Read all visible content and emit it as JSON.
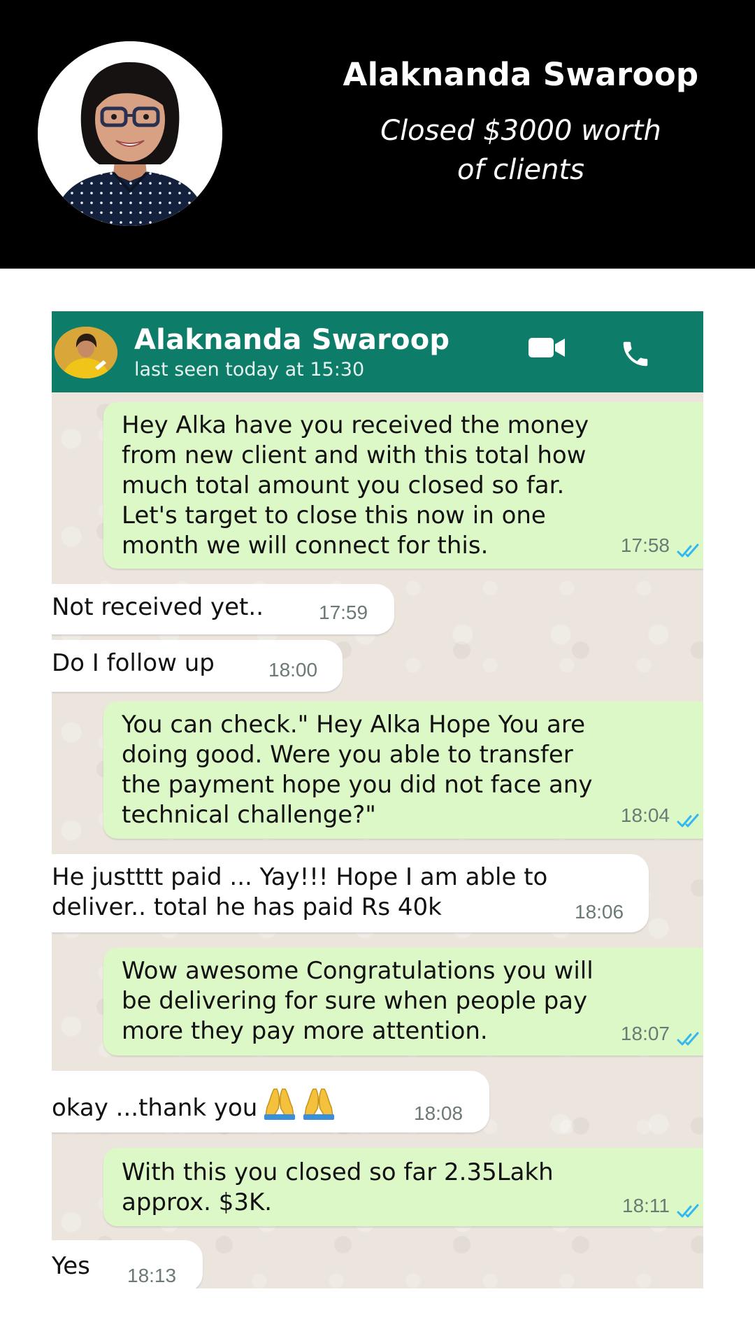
{
  "banner": {
    "name": "Alaknanda Swaroop",
    "subtitle_line1": "Closed $3000 worth",
    "subtitle_line2": "of clients"
  },
  "chat": {
    "contact_name": "Alaknanda Swaroop",
    "last_seen": "last seen today at 15:30",
    "header_icons": [
      "video-call-icon",
      "phone-call-icon"
    ],
    "colors": {
      "header": "#0d7d69",
      "outgoing": "#dcf8c6",
      "incoming": "#ffffff",
      "background": "#ebe5de",
      "read_ticks": "#34b7f1"
    },
    "messages": [
      {
        "dir": "out",
        "text": "Hey Alka have you received the money\nfrom new client and with this total how\nmuch total amount you closed so far.\nLet's target to close this now in one\nmonth we will connect for this.",
        "time": "17:58",
        "read": true
      },
      {
        "dir": "in",
        "text": "Not received yet..",
        "time": "17:59"
      },
      {
        "dir": "in",
        "text": "Do I follow up",
        "time": "18:00"
      },
      {
        "dir": "out",
        "text": "You can check.\" Hey Alka Hope You are\ndoing good. Were you able to transfer\nthe payment hope you did not face any\ntechnical challenge?\"",
        "time": "18:04",
        "read": true
      },
      {
        "dir": "in",
        "text": "He justttt paid ... Yay!!! Hope I am able to\ndeliver.. total he has paid Rs 40k",
        "time": "18:06"
      },
      {
        "dir": "out",
        "text": "Wow awesome Congratulations you will\nbe delivering for sure when people pay\nmore they pay more attention.",
        "time": "18:07",
        "read": true
      },
      {
        "dir": "in",
        "text": "okay ...thank you",
        "emoji": "folded-hands-icon x2",
        "time": "18:08"
      },
      {
        "dir": "out",
        "text": "With this you closed so far 2.35Lakh\napprox. $3K.",
        "time": "18:11",
        "read": true
      },
      {
        "dir": "in",
        "text": "Yes",
        "time": "18:13"
      }
    ]
  }
}
